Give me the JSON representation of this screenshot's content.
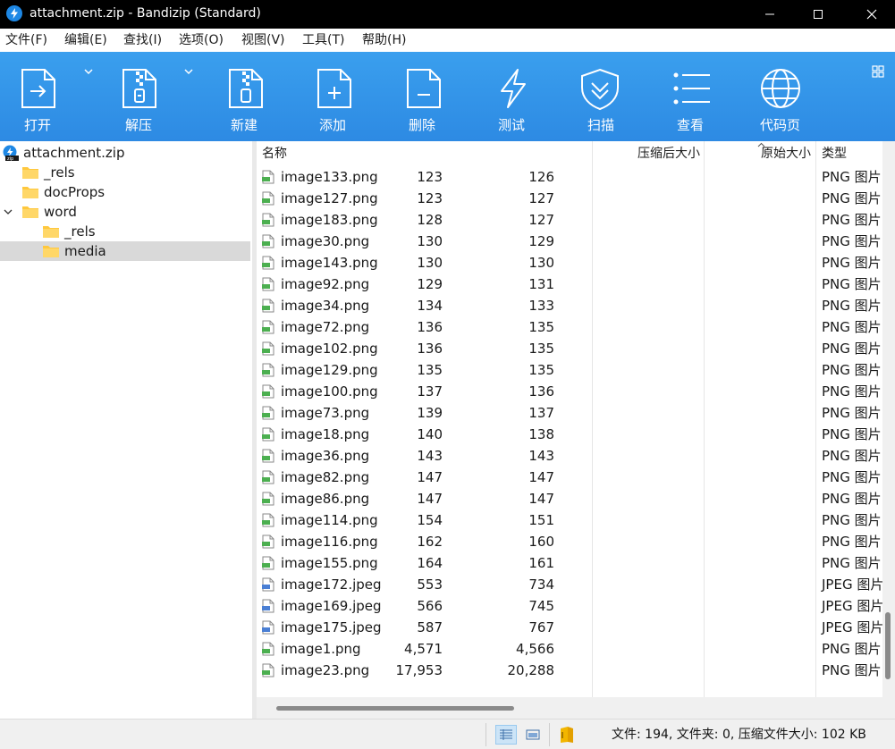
{
  "window": {
    "title": "attachment.zip - Bandizip (Standard)"
  },
  "menu": [
    {
      "label": "文件(F)"
    },
    {
      "label": "编辑(E)"
    },
    {
      "label": "查找(I)"
    },
    {
      "label": "选项(O)"
    },
    {
      "label": "视图(V)"
    },
    {
      "label": "工具(T)"
    },
    {
      "label": "帮助(H)"
    }
  ],
  "toolbar": {
    "open": "打开",
    "extract": "解压",
    "new": "新建",
    "add": "添加",
    "delete": "删除",
    "test": "测试",
    "scan": "扫描",
    "view": "查看",
    "codepage": "代码页"
  },
  "tree": {
    "root": "attachment.zip",
    "items": [
      {
        "label": "_rels"
      },
      {
        "label": "docProps"
      },
      {
        "label": "word"
      },
      {
        "label": "_rels"
      },
      {
        "label": "media"
      }
    ]
  },
  "columns": {
    "name": "名称",
    "compressed": "压缩后大小",
    "original": "原始大小",
    "type": "类型"
  },
  "files": [
    {
      "name": "image133.png",
      "compressed": "123",
      "original": "126",
      "type": "PNG 图片"
    },
    {
      "name": "image127.png",
      "compressed": "123",
      "original": "127",
      "type": "PNG 图片"
    },
    {
      "name": "image183.png",
      "compressed": "128",
      "original": "127",
      "type": "PNG 图片"
    },
    {
      "name": "image30.png",
      "compressed": "130",
      "original": "129",
      "type": "PNG 图片"
    },
    {
      "name": "image143.png",
      "compressed": "130",
      "original": "130",
      "type": "PNG 图片"
    },
    {
      "name": "image92.png",
      "compressed": "129",
      "original": "131",
      "type": "PNG 图片"
    },
    {
      "name": "image34.png",
      "compressed": "134",
      "original": "133",
      "type": "PNG 图片"
    },
    {
      "name": "image72.png",
      "compressed": "136",
      "original": "135",
      "type": "PNG 图片"
    },
    {
      "name": "image102.png",
      "compressed": "136",
      "original": "135",
      "type": "PNG 图片"
    },
    {
      "name": "image129.png",
      "compressed": "135",
      "original": "135",
      "type": "PNG 图片"
    },
    {
      "name": "image100.png",
      "compressed": "137",
      "original": "136",
      "type": "PNG 图片"
    },
    {
      "name": "image73.png",
      "compressed": "139",
      "original": "137",
      "type": "PNG 图片"
    },
    {
      "name": "image18.png",
      "compressed": "140",
      "original": "138",
      "type": "PNG 图片"
    },
    {
      "name": "image36.png",
      "compressed": "143",
      "original": "143",
      "type": "PNG 图片"
    },
    {
      "name": "image82.png",
      "compressed": "147",
      "original": "147",
      "type": "PNG 图片"
    },
    {
      "name": "image86.png",
      "compressed": "147",
      "original": "147",
      "type": "PNG 图片"
    },
    {
      "name": "image114.png",
      "compressed": "154",
      "original": "151",
      "type": "PNG 图片"
    },
    {
      "name": "image116.png",
      "compressed": "162",
      "original": "160",
      "type": "PNG 图片"
    },
    {
      "name": "image155.png",
      "compressed": "164",
      "original": "161",
      "type": "PNG 图片"
    },
    {
      "name": "image172.jpeg",
      "compressed": "553",
      "original": "734",
      "type": "JPEG 图片"
    },
    {
      "name": "image169.jpeg",
      "compressed": "566",
      "original": "745",
      "type": "JPEG 图片"
    },
    {
      "name": "image175.jpeg",
      "compressed": "587",
      "original": "767",
      "type": "JPEG 图片"
    },
    {
      "name": "image1.png",
      "compressed": "4,571",
      "original": "4,566",
      "type": "PNG 图片"
    },
    {
      "name": "image23.png",
      "compressed": "17,953",
      "original": "20,288",
      "type": "PNG 图片"
    }
  ],
  "status": {
    "text": "文件: 194, 文件夹: 0, 压缩文件大小: 102 KB"
  },
  "colors": {
    "toolbar": "#2d8ae3",
    "titlebar": "#000000",
    "selection": "#d9d9d9",
    "folder": "#ffc83d"
  }
}
